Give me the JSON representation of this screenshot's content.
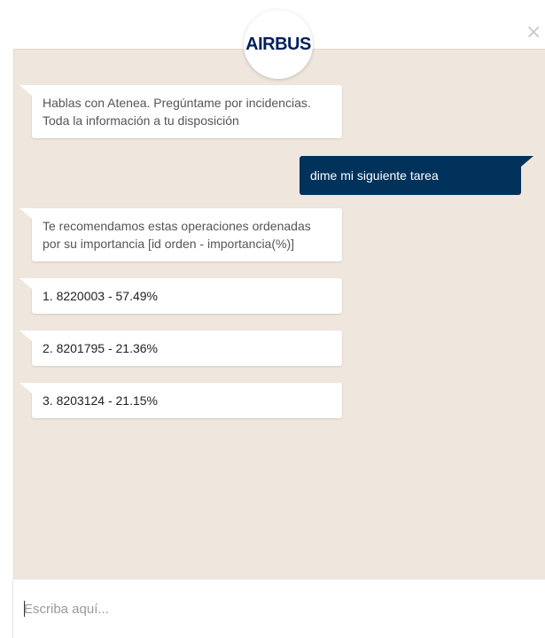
{
  "header": {
    "logo_text": "AIRBUS",
    "close_glyph": "×"
  },
  "messages": [
    {
      "sender": "bot",
      "text": "Hablas con Atenea. Pregúntame por incidencias. Toda la información a tu disposición"
    },
    {
      "sender": "user",
      "text": "dime mi siguiente tarea"
    },
    {
      "sender": "bot",
      "text": "Te recomendamos estas operaciones ordenadas por su importancia [id orden - importancia(%)]"
    },
    {
      "sender": "bot",
      "text": "1. 8220003 - 57.49%"
    },
    {
      "sender": "bot",
      "text": "2. 8201795 - 21.36%"
    },
    {
      "sender": "bot",
      "text": "3. 8203124 - 21.15%"
    }
  ],
  "input": {
    "placeholder": "Escriba aquí...",
    "value": ""
  },
  "colors": {
    "chat_background": "#efe6dd",
    "user_bubble": "#00325b",
    "bot_bubble": "#ffffff",
    "brand": "#00205b"
  },
  "icons": {
    "close": "close-icon",
    "logo": "airbus-logo"
  }
}
